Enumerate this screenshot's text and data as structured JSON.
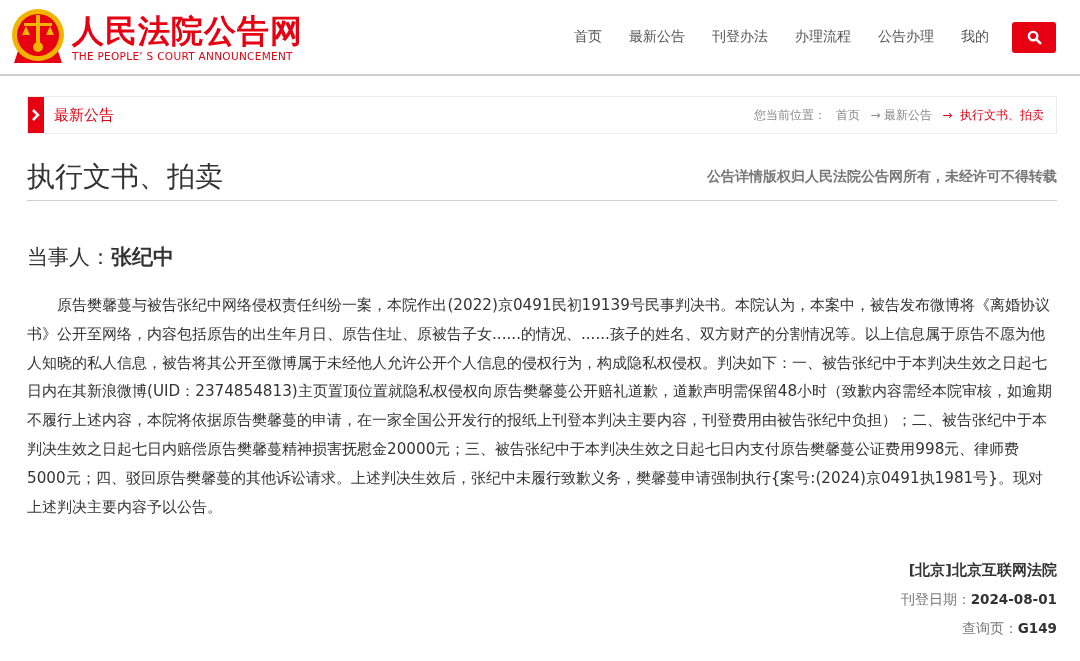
{
  "header": {
    "site_name": "人民法院公告网",
    "site_subtitle": "THE PEOPLE’ S COURT ANNOUNCEMENT",
    "nav": [
      {
        "label": "首页",
        "selected": false
      },
      {
        "label": "最新公告",
        "selected": false
      },
      {
        "label": "刊登办法",
        "selected": false
      },
      {
        "label": "办理流程",
        "selected": false
      },
      {
        "label": "公告办理",
        "selected": false
      },
      {
        "label": "我的",
        "selected": false
      }
    ]
  },
  "section_bar": {
    "title": "最新公告",
    "location_label": "您当前位置：",
    "breadcrumb": [
      {
        "label": "首页",
        "current": false
      },
      {
        "label": "→ 最新公告",
        "current": false
      },
      {
        "label": "→  执行文书、拍卖",
        "current": true
      }
    ]
  },
  "notice": {
    "category": "执行文书、拍卖",
    "copyright": "公告详情版权归人民法院公告网所有，未经许可不得转载",
    "party_label": "当事人：",
    "party_name": "张纪中",
    "body": "原告樊馨蔓与被告张纪中网络侵权责任纠纷一案，本院作出(2022)京0491民初19139号民事判决书。本院认为，本案中，被告发布微博将《离婚协议书》公开至网络，内容包括原告的出生年月日、原告住址、原被告子女......的情况、......孩子的姓名、双方财产的分割情况等。以上信息属于原告不愿为他人知晓的私人信息，被告将其公开至微博属于未经他人允许公开个人信息的侵权行为，构成隐私权侵权。判决如下：一、被告张纪中于本判决生效之日起七日内在其新浪微博(UID：2374854813)主页置顶位置就隐私权侵权向原告樊馨蔓公开赔礼道歉，道歉声明需保留48小时（致歉内容需经本院审核，如逾期不履行上述内容，本院将依据原告樊馨蔓的申请，在一家全国公开发行的报纸上刊登本判决主要内容，刊登费用由被告张纪中负担）；二、被告张纪中于本判决生效之日起七日内赔偿原告樊馨蔓精神损害抚慰金20000元；三、被告张纪中于本判决生效之日起七日内支付原告樊馨蔓公证费用998元、律师费5000元；四、驳回原告樊馨蔓的其他诉讼请求。上述判决生效后，张纪中未履行致歉义务，樊馨蔓申请强制执行{案号:(2024)京0491执1981号}。现对上述判决主要内容予以公告。",
    "court": "[北京]北京互联网法院",
    "meta": [
      {
        "label": "刊登日期：",
        "value": "2024-08-01"
      },
      {
        "label": "查询页：",
        "value": "G149"
      }
    ]
  }
}
